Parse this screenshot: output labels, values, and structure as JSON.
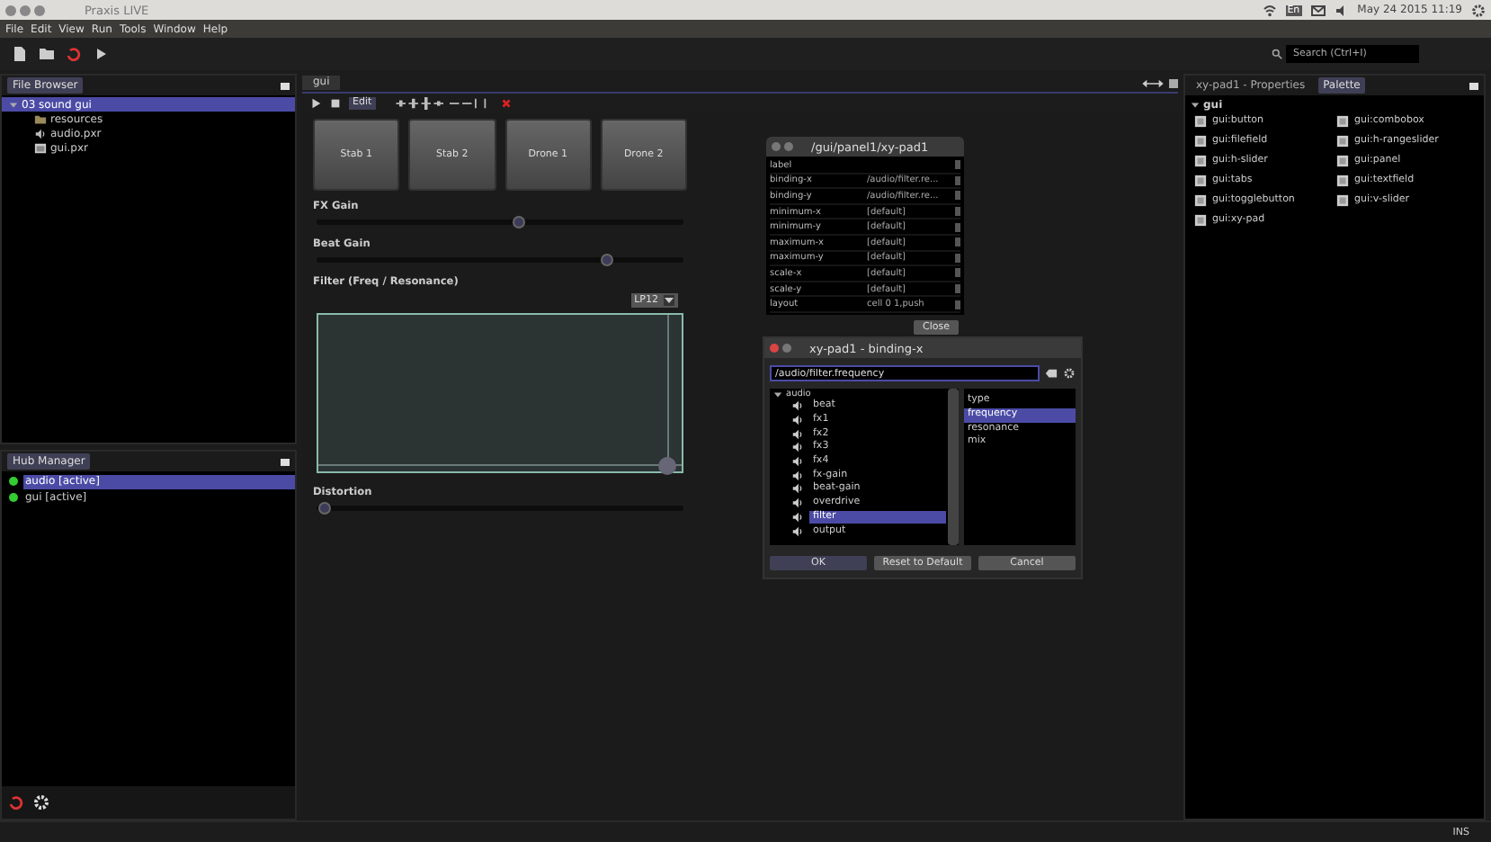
{
  "window": {
    "title": "Praxis LIVE"
  },
  "system_tray": {
    "keyboard": "En",
    "datetime": "May 24 2015 11:19"
  },
  "menu": [
    "File",
    "Edit",
    "View",
    "Run",
    "Tools",
    "Window",
    "Help"
  ],
  "search": {
    "placeholder": "Search (Ctrl+I)"
  },
  "project_panel": {
    "tabs": [
      {
        "label": "File Browser",
        "selected": true
      }
    ],
    "tree": [
      {
        "label": "03 sound gui",
        "selected": true,
        "expanded": true,
        "children": [
          {
            "label": "resources",
            "kind": "folder"
          },
          {
            "label": "audio.pxr",
            "kind": "audio"
          },
          {
            "label": "gui.pxr",
            "kind": "gui"
          }
        ]
      }
    ]
  },
  "hub_manager": {
    "title": "Hub Manager",
    "items": [
      {
        "label": "audio [active]",
        "selected": true
      },
      {
        "label": "gui [active]",
        "selected": false
      }
    ]
  },
  "editor": {
    "tab": "gui",
    "edit_button": "Edit",
    "controls": [
      {
        "kind": "buttons",
        "buttons": [
          "Stab 1",
          "Stab 2",
          "Drone 1",
          "Drone 2"
        ]
      },
      {
        "kind": "slider",
        "label": "FX Gain",
        "level": 0.55
      },
      {
        "kind": "slider",
        "label": "Beat Gain",
        "level": 0.79
      },
      {
        "kind": "xy-pad",
        "label": "Filter (Freq / Resonance)",
        "mode": "LP12",
        "x": {
          "level": 0.96
        },
        "y": {
          "level": 0.04
        }
      },
      {
        "kind": "slider",
        "label": "Distortion",
        "level": 0.02
      }
    ]
  },
  "properties_dialog": {
    "title": "/gui/panel1/xy-pad1",
    "rows": [
      {
        "name": "label"
      },
      {
        "name": "binding-x",
        "value": "/audio/filter.re..."
      },
      {
        "name": "binding-y",
        "value": "/audio/filter.re..."
      },
      {
        "name": "minimum-x",
        "value": "[default]"
      },
      {
        "name": "minimum-y",
        "value": "[default]"
      },
      {
        "name": "maximum-x",
        "value": "[default]"
      },
      {
        "name": "maximum-y",
        "value": "[default]"
      },
      {
        "name": "scale-x",
        "value": "[default]"
      },
      {
        "name": "scale-y",
        "value": "[default]"
      },
      {
        "name": "layout",
        "value": "cell 0 1,push"
      }
    ],
    "close_button": "Close"
  },
  "binding_dialog": {
    "title": "xy-pad1 - binding-x",
    "value": "/audio/filter.frequency",
    "tree": {
      "label": "audio",
      "expanded": true,
      "children": [
        {
          "label": "beat",
          "selected": false
        },
        {
          "label": "fx1",
          "selected": false
        },
        {
          "label": "fx2",
          "selected": false
        },
        {
          "label": "fx3",
          "selected": false
        },
        {
          "label": "fx4",
          "selected": false
        },
        {
          "label": "fx-gain",
          "selected": false
        },
        {
          "label": "beat-gain",
          "selected": false
        },
        {
          "label": "overdrive",
          "selected": false
        },
        {
          "label": "filter",
          "selected": true
        },
        {
          "label": "output",
          "selected": false
        }
      ]
    },
    "properties": [
      {
        "label": "type",
        "selected": false
      },
      {
        "label": "frequency",
        "selected": true
      },
      {
        "label": "resonance",
        "selected": false
      },
      {
        "label": "mix",
        "selected": false
      }
    ],
    "buttons": [
      "OK",
      "Reset to Default",
      "Cancel"
    ]
  },
  "right_panel": {
    "tabs": [
      {
        "label": "xy-pad1 - Properties",
        "selected": false
      },
      {
        "label": "Palette",
        "selected": true
      }
    ],
    "palette": {
      "category": "gui",
      "expanded": true,
      "items": [
        "gui:button",
        "gui:combobox",
        "gui:filefield",
        "gui:h-rangeslider",
        "gui:h-slider",
        "gui:panel",
        "gui:tabs",
        "gui:textfield",
        "gui:togglebutton",
        "gui:v-slider",
        "gui:xy-pad"
      ]
    }
  },
  "status_bar": {
    "mode": "INS"
  }
}
